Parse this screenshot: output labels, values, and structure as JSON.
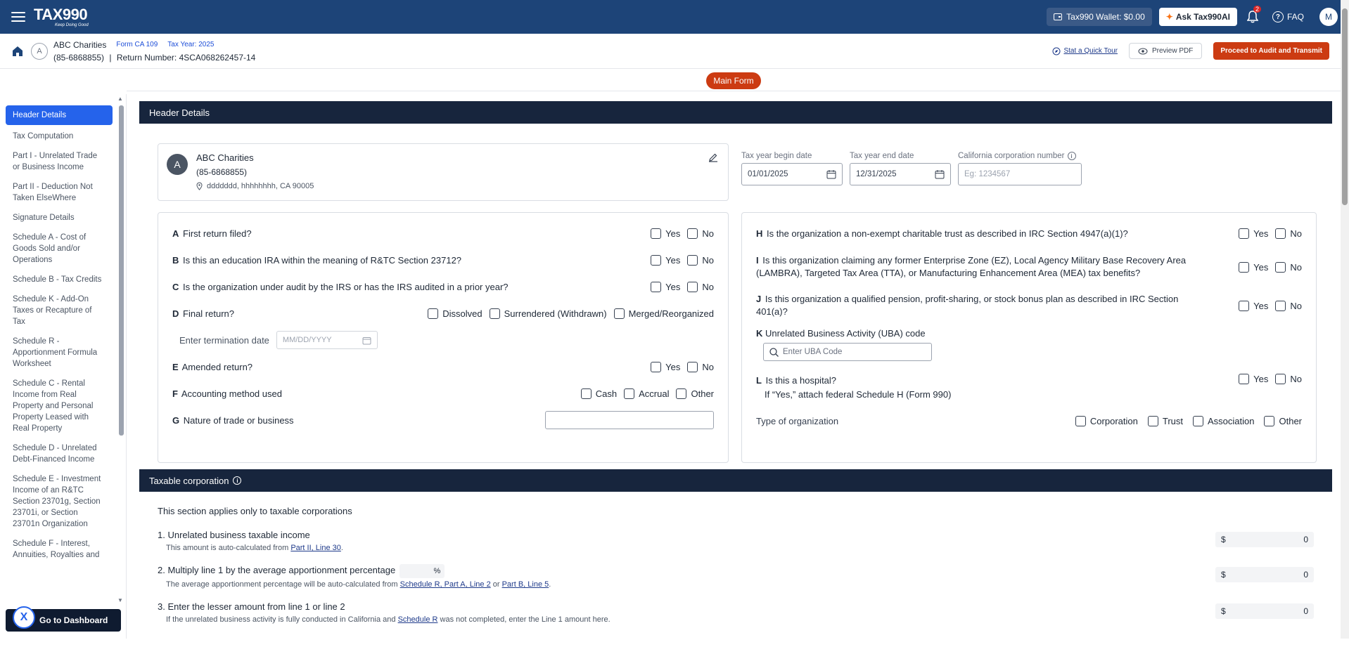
{
  "topbar": {
    "logo": "TAX990",
    "tagline": "Keep Doing Good",
    "wallet": "Tax990 Wallet: $0.00",
    "ask": "Ask Tax990AI",
    "notif_count": "2",
    "faq": "FAQ",
    "user_initial": "M"
  },
  "subheader": {
    "org_initial": "A",
    "org_name": "ABC Charities",
    "form": "Form CA 109",
    "tax_year": "Tax Year: 2025",
    "ein": "(85-6868855)",
    "return_number": "Return Number: 4SCA068262457-14",
    "tour": "Stat a Quick Tour",
    "preview": "Preview PDF",
    "proceed": "Proceed to Audit and Transmit"
  },
  "main_form_pill": "Main Form",
  "sidebar": {
    "items": [
      "Header Details",
      "Tax Computation",
      "Part I - Unrelated Trade or Business Income",
      "Part II - Deduction Not Taken ElseWhere",
      "Signature Details",
      "Schedule A - Cost of Goods Sold and/or Operations",
      "Schedule B - Tax Credits",
      "Schedule K - Add-On Taxes or Recapture of Tax",
      "Schedule R - Apportionment Formula Worksheet",
      "Schedule C - Rental Income from Real Property and Personal Property Leased with Real Property",
      "Schedule D - Unrelated Debt-Financed Income",
      "Schedule E - Investment Income of an R&TC Section 23701g, Section 23701i, or Section 23701n Organization",
      "Schedule F - Interest, Annuities, Royalties and"
    ],
    "dashboard": "Go to Dashboard"
  },
  "header_details": {
    "title": "Header Details",
    "org_initial": "A",
    "org_name": "ABC Charities",
    "ein": "(85-6868855)",
    "address": "ddddddd, hhhhhhhh, CA 90005",
    "begin_label": "Tax year begin date",
    "begin_value": "01/01/2025",
    "end_label": "Tax year end date",
    "end_value": "12/31/2025",
    "corp_label": "California corporation number",
    "corp_placeholder": "Eg: 1234567"
  },
  "questions_left": {
    "a_letter": "A",
    "a_text": "First return filed?",
    "b_letter": "B",
    "b_text": "Is this an education IRA within the meaning of R&TC Section 23712?",
    "c_letter": "C",
    "c_text": "Is the organization under audit by the IRS or has the IRS audited in a prior year?",
    "d_letter": "D",
    "d_text": "Final return?",
    "d_opt1": "Dissolved",
    "d_opt2": "Surrendered (Withdrawn)",
    "d_opt3": "Merged/Reorganized",
    "term_label": "Enter termination date",
    "term_placeholder": "MM/DD/YYYY",
    "e_letter": "E",
    "e_text": "Amended return?",
    "f_letter": "F",
    "f_text": "Accounting method used",
    "f_opt1": "Cash",
    "f_opt2": "Accrual",
    "f_opt3": "Other",
    "g_letter": "G",
    "g_text": "Nature of trade or business",
    "yes": "Yes",
    "no": "No"
  },
  "questions_right": {
    "h_letter": "H",
    "h_text": "Is the organization a non-exempt charitable trust as described in IRC Section 4947(a)(1)?",
    "i_letter": "I",
    "i_text": "Is this organization claiming any former Enterprise Zone (EZ), Local Agency Military Base Recovery Area (LAMBRA), Targeted Tax Area (TTA), or Manufacturing Enhancement Area (MEA) tax benefits?",
    "j_letter": "J",
    "j_text": "Is this organization a qualified pension, profit-sharing, or stock bonus plan as described in IRC Section 401(a)?",
    "k_letter": "K",
    "k_text": "Unrelated Business Activity (UBA) code",
    "k_placeholder": "Enter UBA Code",
    "l_letter": "L",
    "l_text": "Is this a hospital?",
    "l_sub": "If “Yes,” attach federal Schedule H (Form 990)",
    "type_label": "Type of organization",
    "type_opt1": "Corporation",
    "type_opt2": "Trust",
    "type_opt3": "Association",
    "type_opt4": "Other",
    "yes": "Yes",
    "no": "No"
  },
  "taxable": {
    "title": "Taxable corporation",
    "intro": "This section applies only to taxable corporations",
    "l1": "1. Unrelated business taxable income",
    "l1_sub": "This amount is auto-calculated from",
    "l1_link": "Part II, Line 30",
    "l1_amt": "0",
    "l2": "2. Multiply line 1 by the average apportionment percentage",
    "l2_pct": "%",
    "l2_sub": "The average apportionment percentage will be auto-calculated from",
    "l2_link1": "Schedule R, Part A, Line 2",
    "l2_or": "or",
    "l2_link2": "Part B, Line 5",
    "l2_amt": "0",
    "l3": "3. Enter the lesser amount from line 1 or line 2",
    "l3_sub": "If the unrelated business activity is fully conducted in California and",
    "l3_link": "Schedule R",
    "l3_sub2": "was not completed, enter the Line 1 amount here.",
    "l3_amt": "0",
    "currency": "$"
  }
}
